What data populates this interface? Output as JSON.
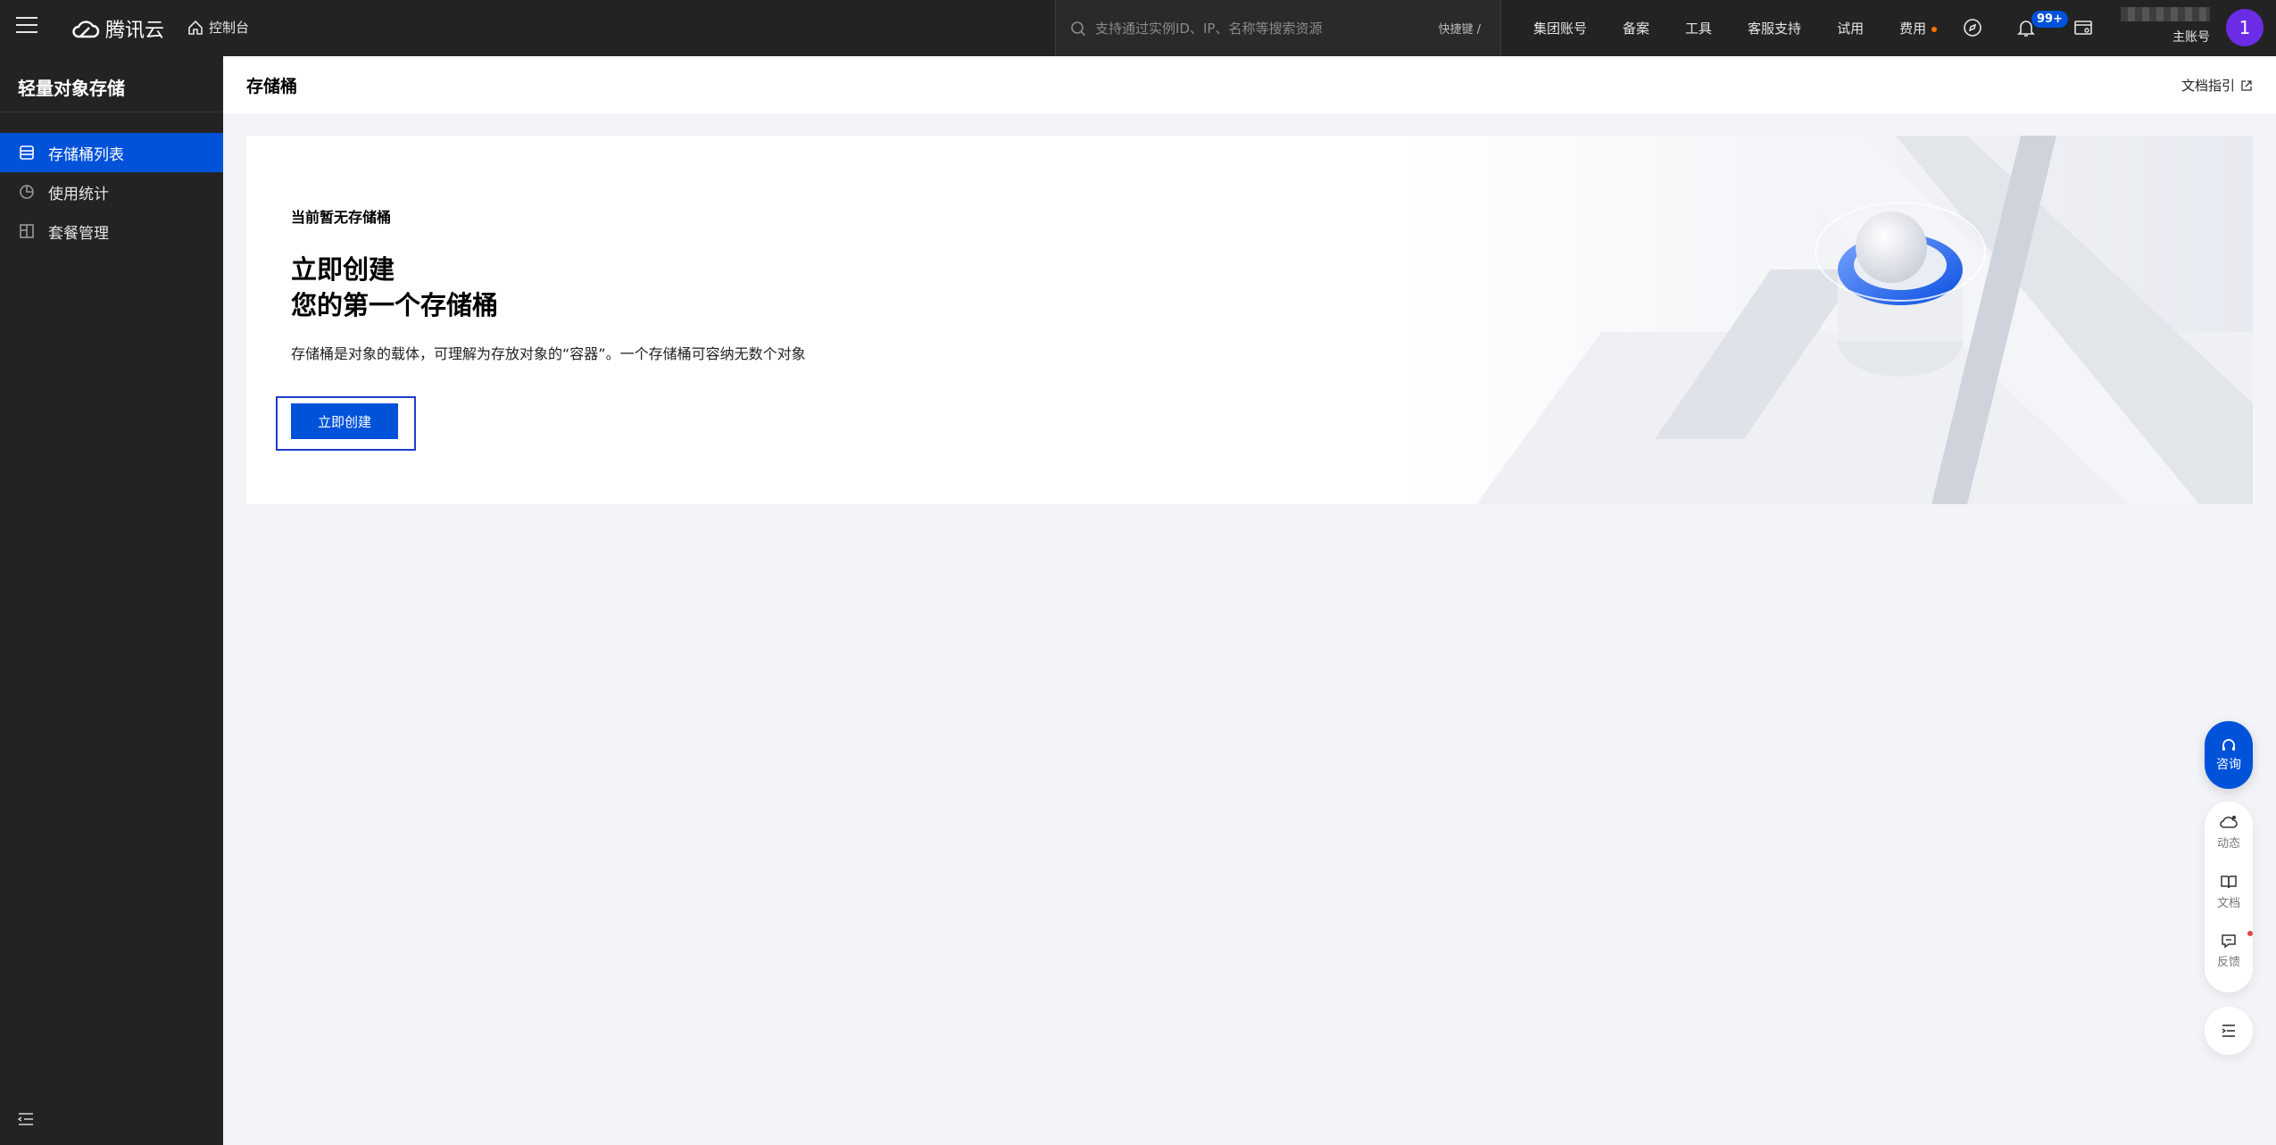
{
  "topbar": {
    "brand": "腾讯云",
    "console_label": "控制台",
    "search_placeholder": "支持通过实例ID、IP、名称等搜索资源",
    "shortcut_label": "快捷键 /",
    "nav": [
      "集团账号",
      "备案",
      "工具",
      "客服支持",
      "试用",
      "费用"
    ],
    "notification_count": "99+",
    "account_label": "主账号",
    "avatar_letter": "1"
  },
  "sidebar": {
    "title": "轻量对象存储",
    "items": [
      {
        "label": "存储桶列表",
        "icon": "bucket-list-icon",
        "active": true
      },
      {
        "label": "使用统计",
        "icon": "pie-chart-icon",
        "active": false
      },
      {
        "label": "套餐管理",
        "icon": "package-icon",
        "active": false
      }
    ]
  },
  "main": {
    "page_title": "存储桶",
    "doc_guide": "文档指引",
    "card": {
      "empty_label": "当前暂无存储桶",
      "headline_1": "立即创建",
      "headline_2": "您的第一个存储桶",
      "description": "存储桶是对象的载体，可理解为存放对象的“容器”。一个存储桶可容纳无数个对象",
      "create_button": "立即创建"
    }
  },
  "float_tools": {
    "consult": "咨询",
    "dynamic": "动态",
    "docs": "文档",
    "feedback": "反馈"
  },
  "colors": {
    "primary": "#0052d9",
    "topbar_bg": "#232323",
    "page_bg": "#f2f4f8",
    "avatar": "#6b2ce6"
  }
}
